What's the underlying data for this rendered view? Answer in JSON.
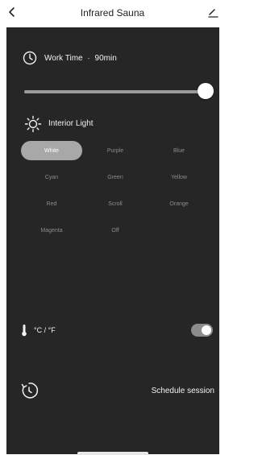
{
  "header": {
    "title": "Infrared Sauna",
    "back_icon": "chevron-left-icon",
    "edit_icon": "pencil-icon"
  },
  "work_time": {
    "icon": "clock-icon",
    "label": "Work Time",
    "separator": "·",
    "value": "90min",
    "slider_level": 1.0
  },
  "interior_light": {
    "icon": "sun-icon",
    "label": "Interior Light",
    "selected": "White",
    "options": [
      "White",
      "Purple",
      "Blue",
      "Cyan",
      "Green",
      "Yellow",
      "Red",
      "Scroll",
      "Orange",
      "Magenta",
      "Off"
    ]
  },
  "unit": {
    "icon": "thermometer-icon",
    "label": "°C / °F",
    "toggle_on": true
  },
  "schedule": {
    "icon": "timer-reset-icon",
    "label": "Schedule session"
  },
  "colors": {
    "panel": "#262626",
    "selected_option": "#a8a8a8"
  }
}
